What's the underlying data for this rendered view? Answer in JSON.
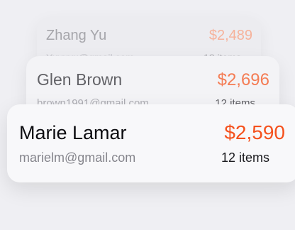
{
  "colors": {
    "background": "#efeff3",
    "accent": "#f5511d"
  },
  "cards": [
    {
      "name": "Zhang Yu",
      "email": "Yuyuyu@gmail.com",
      "price": "$2,489",
      "items": "12 items"
    },
    {
      "name": "Glen Brown",
      "email": "brown1991@gmail.com",
      "price": "$2,696",
      "items": "12 items"
    },
    {
      "name": "Marie Lamar",
      "email": "marielm@gmail.com",
      "price": "$2,590",
      "items": "12 items"
    }
  ]
}
